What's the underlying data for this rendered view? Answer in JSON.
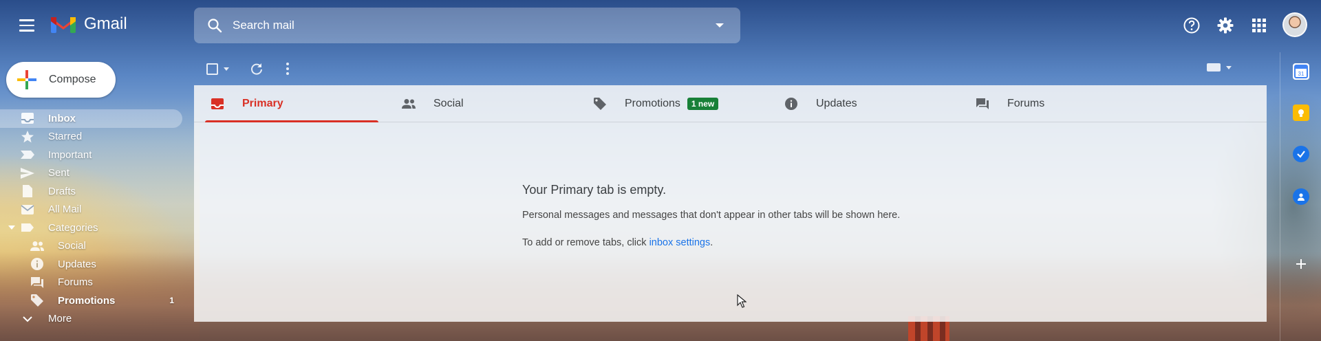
{
  "app": {
    "name": "Gmail"
  },
  "search": {
    "placeholder": "Search mail"
  },
  "compose": {
    "label": "Compose"
  },
  "sidebar": {
    "items": [
      {
        "label": "Inbox",
        "icon": "inbox-icon",
        "active": true
      },
      {
        "label": "Starred",
        "icon": "star-icon"
      },
      {
        "label": "Important",
        "icon": "important-icon"
      },
      {
        "label": "Sent",
        "icon": "send-icon"
      },
      {
        "label": "Drafts",
        "icon": "draft-icon"
      },
      {
        "label": "All Mail",
        "icon": "mail-icon"
      },
      {
        "label": "Categories",
        "icon": "label-icon"
      }
    ],
    "categories": [
      {
        "label": "Social",
        "icon": "people-icon"
      },
      {
        "label": "Updates",
        "icon": "info-icon"
      },
      {
        "label": "Forums",
        "icon": "forum-icon"
      },
      {
        "label": "Promotions",
        "icon": "tag-icon",
        "count": "1"
      }
    ],
    "more_label": "More"
  },
  "tabs": [
    {
      "label": "Primary",
      "icon": "inbox-icon",
      "active": true
    },
    {
      "label": "Social",
      "icon": "people-icon"
    },
    {
      "label": "Promotions",
      "icon": "tag-icon",
      "badge": "1 new"
    },
    {
      "label": "Updates",
      "icon": "info-icon"
    },
    {
      "label": "Forums",
      "icon": "forum-icon"
    }
  ],
  "empty_state": {
    "title": "Your Primary tab is empty.",
    "description": "Personal messages and messages that don't appear in other tabs will be shown here.",
    "hint_prefix": "To add or remove tabs, click ",
    "hint_link": "inbox settings",
    "hint_suffix": "."
  },
  "colors": {
    "accent_red": "#d93025",
    "badge_green": "#188038",
    "link_blue": "#1a73e8"
  }
}
